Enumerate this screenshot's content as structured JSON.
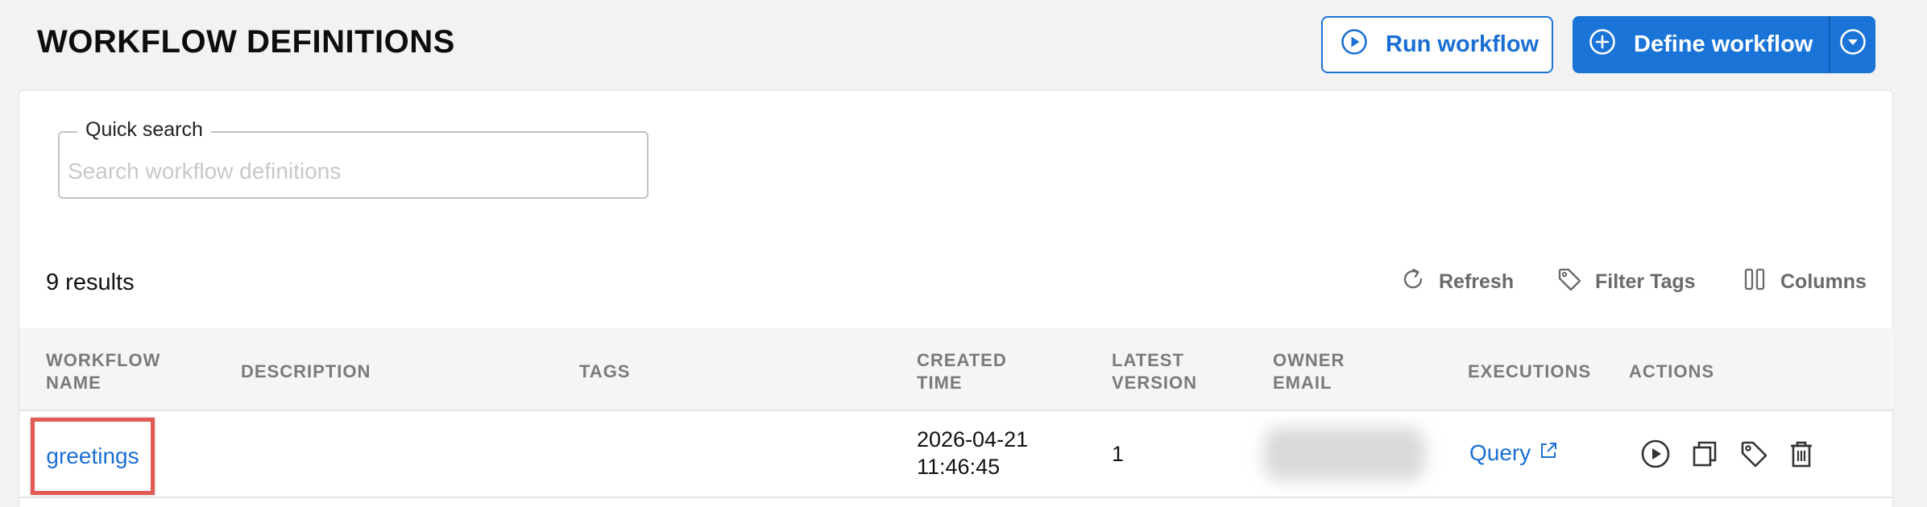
{
  "header": {
    "title": "WORKFLOW DEFINITIONS",
    "run_label": "Run workflow",
    "define_label": "Define workflow"
  },
  "search": {
    "label": "Quick search",
    "placeholder": "Search workflow definitions",
    "value": ""
  },
  "toolbar": {
    "results": "9 results",
    "refresh": "Refresh",
    "filter_tags": "Filter Tags",
    "columns": "Columns"
  },
  "table": {
    "columns": [
      "WORKFLOW\nNAME",
      "DESCRIPTION",
      "TAGS",
      "CREATED\nTIME",
      "LATEST\nVERSION",
      "OWNER\nEMAIL",
      "EXECUTIONS",
      "ACTIONS"
    ],
    "rows": [
      {
        "name": "greetings",
        "description": "",
        "tags": "",
        "created_date": "2026-04-21",
        "created_time": "11:46:45",
        "version": "1",
        "executions": "Query"
      }
    ]
  },
  "icons": {
    "run_btn": "play-circle-icon",
    "define_btn": "plus-circle-icon",
    "define_dropdown": "chevron-down-circle-icon",
    "refresh": "refresh-icon",
    "filter_tags": "tag-icon",
    "columns": "columns-icon",
    "query_external": "external-link-icon",
    "actions": [
      "play-circle-icon",
      "copy-icon",
      "tag-icon",
      "trash-icon"
    ]
  },
  "colors": {
    "accent": "#1a74d8",
    "highlight_border": "#e35a54"
  }
}
